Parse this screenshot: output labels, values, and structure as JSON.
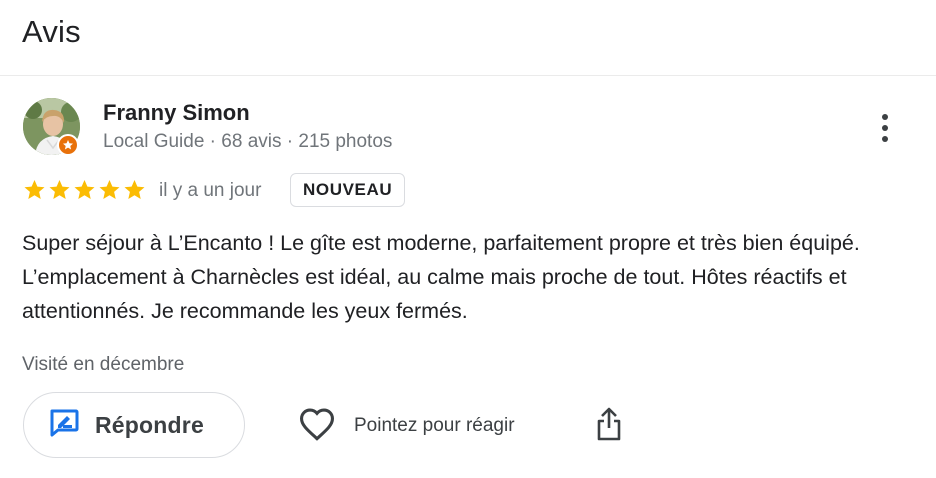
{
  "section": {
    "title": "Avis"
  },
  "review": {
    "author": {
      "name": "Franny Simon",
      "meta": "Local Guide · 68 avis · 215 photos",
      "avatar_icon": "user-photo",
      "badge_icon": "local-guide-star-icon",
      "badge_color": "#e8710a"
    },
    "rating": 5,
    "rating_max": 5,
    "star_color": "#fbbc04",
    "time_ago": "il y a un jour",
    "badge": "NOUVEAU",
    "text": "Super séjour à L’Encanto ! Le gîte est moderne, parfaitement propre et très bien équipé. L’emplacement à Charnècles est idéal, au calme mais proche de tout. Hôtes réactifs et attentionnés. Je recommande les yeux fermés.",
    "visited": "Visité en décembre"
  },
  "actions": {
    "reply_label": "Répondre",
    "reply_icon": "reply-edit-icon",
    "reply_icon_color": "#1a73e8",
    "react_label": "Pointez pour réagir",
    "react_icon": "heart-outline-icon",
    "share_icon": "share-icon",
    "more_icon": "more-vertical-icon"
  }
}
